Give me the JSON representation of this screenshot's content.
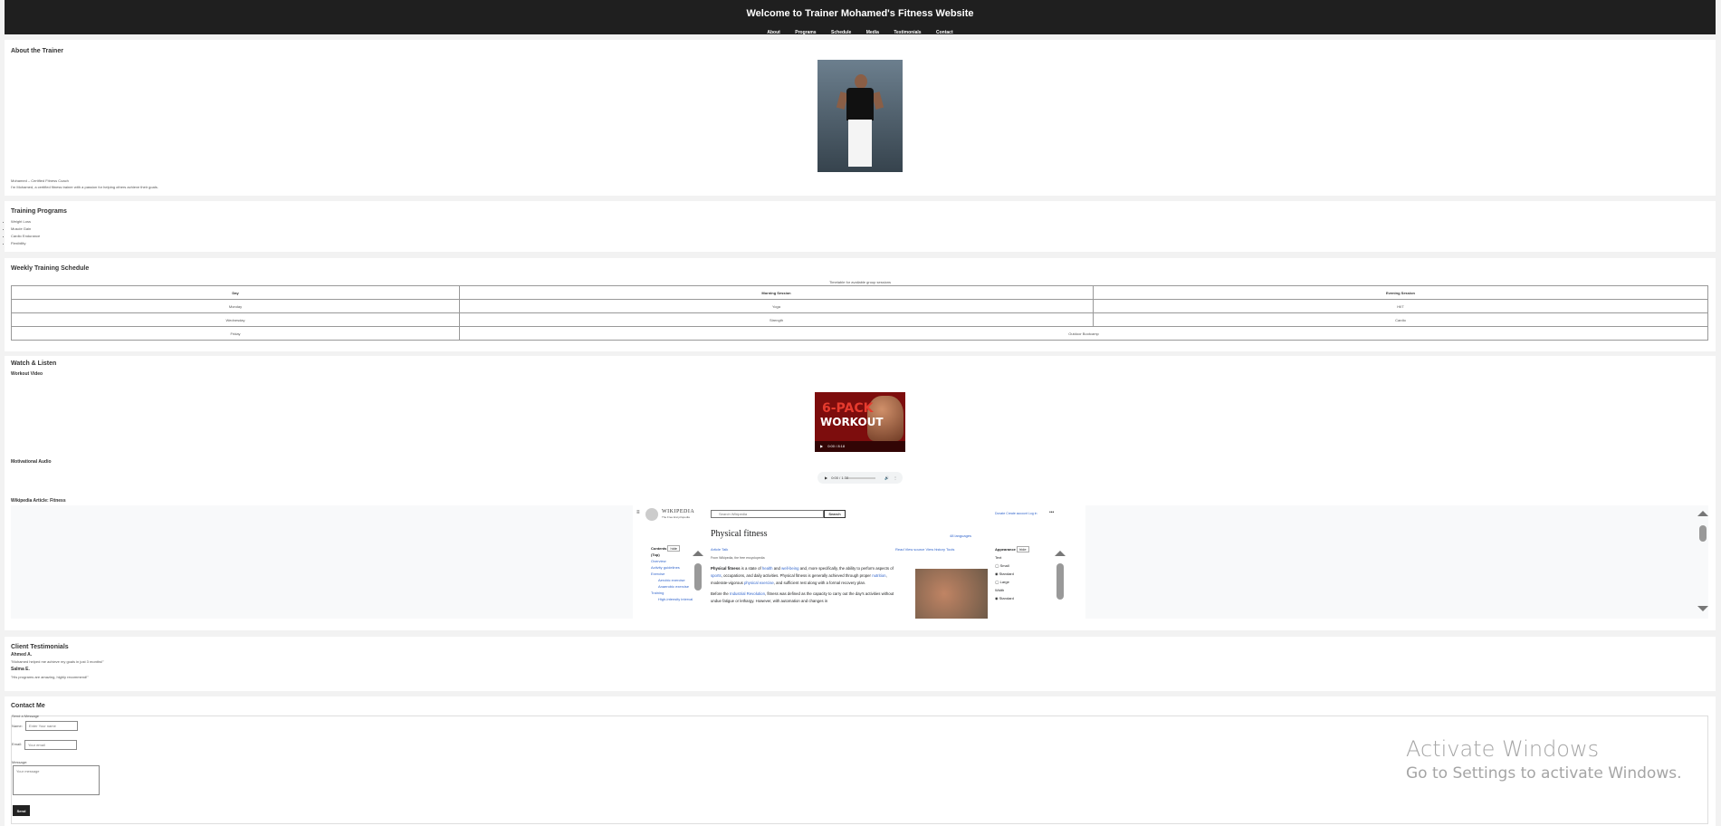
{
  "header": {
    "title": "Welcome to Trainer Mohamed's Fitness Website",
    "nav": [
      "About",
      "Programs",
      "Schedule",
      "Media",
      "Testimonials",
      "Contact"
    ]
  },
  "about": {
    "heading": "About the Trainer",
    "caption": "Mohamed – Certified Fitness Coach",
    "bio": "I'm Mohamed, a certified fitness trainer with a passion for helping others achieve their goals."
  },
  "programs": {
    "heading": "Training Programs",
    "items": [
      "Weight Loss",
      "Muscle Gain",
      "Cardio Endurance",
      "Flexibility"
    ]
  },
  "schedule": {
    "heading": "Weekly Training Schedule",
    "caption": "Timetable for available group sessions",
    "columns": [
      "Day",
      "Morning Session",
      "Evening Session"
    ],
    "rows": [
      [
        "Monday",
        "Yoga",
        "HIIT"
      ],
      [
        "Wednesday",
        "Strength",
        "Cardio"
      ],
      [
        "Friday",
        "Outdoor Bootcamp"
      ]
    ]
  },
  "media": {
    "heading": "Watch & Listen",
    "video_label": "Workout Video",
    "video_thumb_line1": "6-PACK",
    "video_thumb_line2": "WORKOUT",
    "video_time": "0:00 / 8:18",
    "audio_label": "Motivational Audio",
    "audio_time": "0:00 / 1:38",
    "wiki_label": "Wikipedia Article: Fitness",
    "wiki": {
      "wordmark": "WIKIPEDIA",
      "tagline": "The Free Encyclopedia",
      "search_placeholder": "Search Wikipedia",
      "search_button": "Search",
      "top_links": "Donate  Create account  Log in",
      "title": "Physical fitness",
      "languages": "48 languages",
      "tabs_left": "Article   Talk",
      "tabs_right": "Read   View source   View history   Tools",
      "from_line": "From Wikipedia, the free encyclopedia",
      "para1_a": "Physical fitness",
      "para1_b": " is a state of ",
      "para1_c": "health",
      "para1_d": " and ",
      "para1_e": "well-being",
      "para1_f": " and, more specifically, the ability to perform aspects of ",
      "para1_g": "sports",
      "para1_h": ", occupations, and daily activities. Physical fitness is generally achieved through proper ",
      "para1_i": "nutrition",
      "para1_j": ", moderate-vigorous ",
      "para1_k": "physical exercise",
      "para1_l": ", and sufficient rest along with a formal recovery plan.",
      "para2_a": "Before the ",
      "para2_b": "Industrial Revolution",
      "para2_c": ", fitness was defined as the capacity to carry out the day's activities without undue fatigue or lethargy. However, with automation and changes in",
      "sidebar_title": "Contents",
      "sidebar_hide": "hide",
      "sidebar_items": [
        "(Top)",
        "Overview",
        "Activity guidelines",
        "Exercise",
        "Aerobic exercise",
        "Anaerobic exercise",
        "Training",
        "High-intensity interval"
      ],
      "appearance_title": "Appearance",
      "appearance_hide": "hide",
      "text_label": "Text",
      "text_options": [
        "Small",
        "Standard",
        "Large"
      ],
      "width_label": "Width",
      "width_options": [
        "Standard"
      ]
    }
  },
  "testimonials": {
    "heading": "Client Testimonials",
    "items": [
      {
        "name": "Ahmed A.",
        "quote": "\"Mohamed helped me achieve my goals in just 3 months!\""
      },
      {
        "name": "Salma E.",
        "quote": "\"His programs are amazing, highly recommend!\""
      }
    ]
  },
  "contact": {
    "heading": "Contact Me",
    "legend": "Send a Message",
    "name_label": "Name:",
    "name_placeholder": "Enter Your name",
    "email_label": "Email:",
    "email_placeholder": "Your email",
    "message_label": "Message:",
    "message_placeholder": "Your message",
    "send_label": "Send"
  },
  "watermark": {
    "line1": "Activate Windows",
    "line2": "Go to Settings to activate Windows."
  }
}
